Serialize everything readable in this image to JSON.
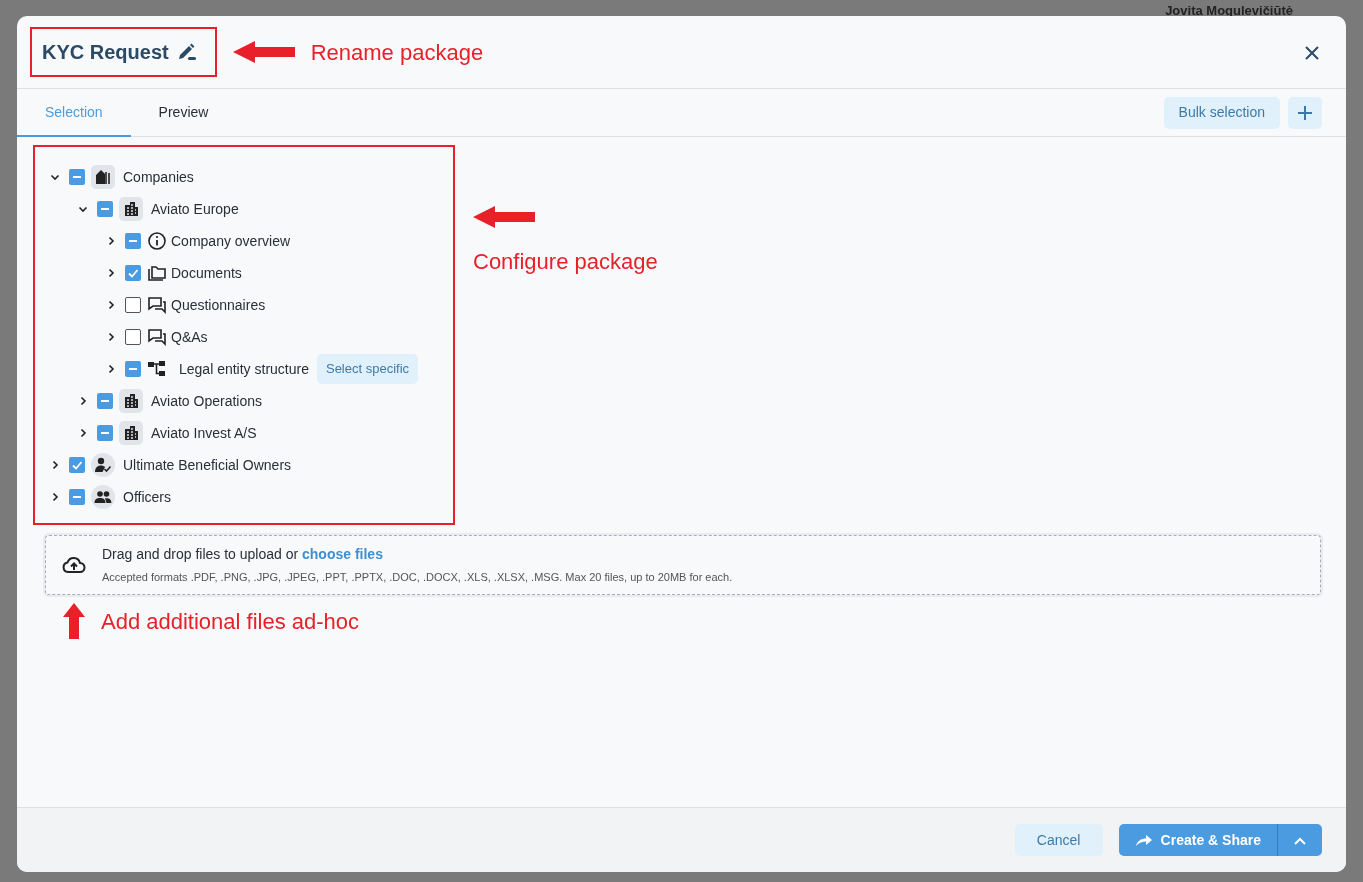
{
  "background": {
    "user_name": "Jovita Mogulevičiūtė"
  },
  "dialog": {
    "title": "KYC Request",
    "annotation": "Rename package"
  },
  "tabs": [
    {
      "label": "Selection",
      "selected": true
    },
    {
      "label": "Preview",
      "selected": false
    }
  ],
  "toolbar": {
    "bulk_selection": "Bulk selection"
  },
  "tree": [
    {
      "label": "Companies",
      "kind": "companies",
      "expanded": true,
      "checked": false,
      "indeterminate": true,
      "children": [
        {
          "label": "Aviato Europe",
          "kind": "company",
          "expanded": true,
          "checked": false,
          "indeterminate": true,
          "children": [
            {
              "label": "Company overview",
              "kind": "info",
              "expanded": false,
              "checked": false,
              "indeterminate": true
            },
            {
              "label": "Documents",
              "kind": "folder",
              "expanded": false,
              "checked": true,
              "indeterminate": false
            },
            {
              "label": "Questionnaires",
              "kind": "chat",
              "expanded": false,
              "checked": false,
              "indeterminate": false
            },
            {
              "label": "Q&As",
              "kind": "chat",
              "expanded": false,
              "checked": false,
              "indeterminate": false
            },
            {
              "label": "Legal entity structure",
              "kind": "hierarchy",
              "expanded": false,
              "checked": false,
              "indeterminate": true,
              "action": "Select specific"
            }
          ]
        },
        {
          "label": "Aviato Operations",
          "kind": "company",
          "expanded": false,
          "checked": false,
          "indeterminate": true
        },
        {
          "label": "Aviato Invest A/S",
          "kind": "company",
          "expanded": false,
          "checked": false,
          "indeterminate": true
        }
      ]
    },
    {
      "label": "Ultimate Beneficial Owners",
      "kind": "person",
      "expanded": false,
      "checked": true,
      "indeterminate": false
    },
    {
      "label": "Officers",
      "kind": "people",
      "expanded": false,
      "checked": false,
      "indeterminate": true
    }
  ],
  "tree_annotation": "Configure package",
  "upload": {
    "prompt": "Drag and drop files to upload or",
    "link": "choose files",
    "hint": "Accepted formats .PDF, .PNG, .JPG, .JPEG, .PPT, .PPTX, .DOC, .DOCX, .XLS, .XLSX, .MSG. Max 20 files, up to 20MB for each.",
    "annotation": "Add additional files ad-hoc"
  },
  "footer": {
    "cancel": "Cancel",
    "submit": "Create & Share"
  }
}
